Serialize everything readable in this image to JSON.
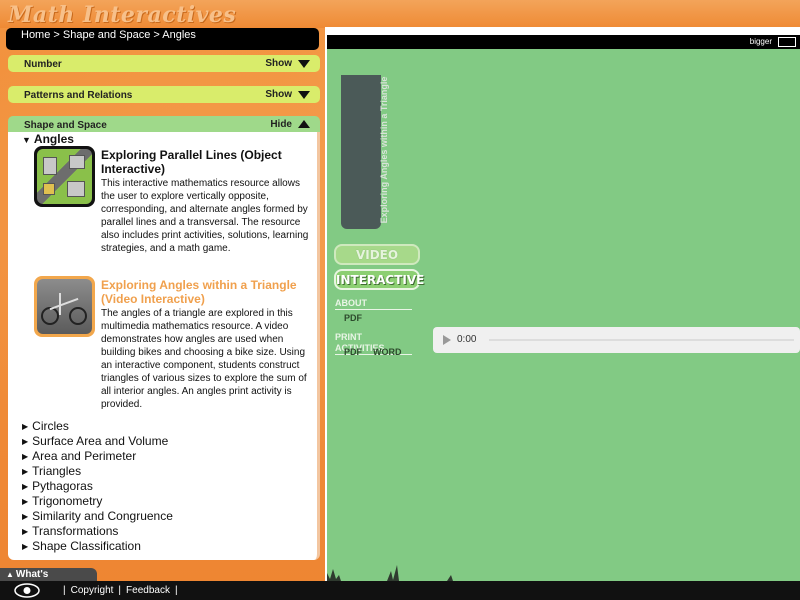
{
  "app": {
    "logo_text": "Math Interactives"
  },
  "breadcrumb": {
    "text": "Home > Shape and Space > Angles"
  },
  "sections": [
    {
      "label": "Number",
      "toggle": "Show"
    },
    {
      "label": "Patterns and Relations",
      "toggle": "Show"
    },
    {
      "label": "Shape and Space",
      "toggle": "Hide"
    }
  ],
  "open_topic": "Angles",
  "resources": [
    {
      "title": "Exploring Parallel Lines (Object Interactive)",
      "description": "This interactive mathematics resource allows the user to explore vertically opposite, corresponding, and alternate angles formed by parallel lines and a transversal. The resource also includes print activities, solutions, learning strategies, and a math game."
    },
    {
      "title": "Exploring Angles within a Triangle (Video Interactive)",
      "description": "The angles of a triangle are explored in this multimedia mathematics resource. A video demonstrates how angles are used when building bikes and choosing a bike size. Using an interactive component, students construct triangles of various sizes to explore the sum of all interior angles. An angles print activity is provided."
    }
  ],
  "topics": [
    "Circles",
    "Surface Area and Volume",
    "Area and Perimeter",
    "Triangles",
    "Pythagoras",
    "Trigonometry",
    "Similarity and Congruence",
    "Transformations",
    "Shape Classification"
  ],
  "whats_included": "What's Included?",
  "footer": {
    "copyright": "Copyright",
    "feedback": "Feedback"
  },
  "stage": {
    "bigger_label": "bigger",
    "strip_title": "Exploring Angles within a Triangle",
    "video_button": "VIDEO",
    "interactive_button": "INTERACTIVE",
    "about_heading": "ABOUT",
    "about_pdf": "PDF",
    "print_heading": "PRINT ACTIVITIES",
    "print_pdf": "PDF",
    "print_word": "WORD",
    "audio_time": "0:00"
  },
  "colors": {
    "section_bar": "#d9ec6b",
    "section_bar_active": "#9fd98a",
    "stage_green": "#82ca84",
    "highlight_title": "#f0a04d",
    "background_orange": "#ef8a34"
  },
  "icons": [
    "triangle-down-icon",
    "triangle-up-icon",
    "topic-arrow-icon",
    "expand-icon",
    "play-icon",
    "eye-logo-icon"
  ]
}
